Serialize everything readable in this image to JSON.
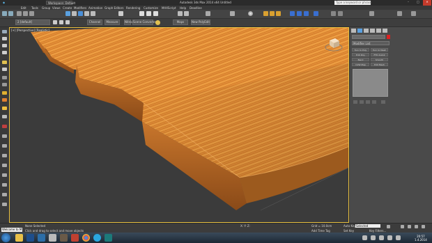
{
  "titlebar": {
    "workspace": "Workspace: Default",
    "title": "Autodesk 3ds Max 2014 x64    Untitled",
    "search_placeholder": "Type a keyword or phrase",
    "win_min": "–",
    "win_max": "□",
    "win_close": "✕"
  },
  "menus": [
    "Edit",
    "Tools",
    "Group",
    "Views",
    "Create",
    "Modifiers",
    "Animation",
    "Graph Editors",
    "Rendering",
    "Customize",
    "MAXScript",
    "Help",
    "Deadline"
  ],
  "toolbar2": {
    "selection_set": "2 [default]",
    "buttons": [
      "Channel",
      "Measure",
      "Nitrous",
      "Scene Converter",
      "Maps",
      "New PolyEdit"
    ]
  },
  "viewport": {
    "label": "[+] [Perspective] [Realistic]"
  },
  "command_panel": {
    "modifier_list": "Modifier List",
    "modifier_buttons": [
      "Turn to Poly",
      "Turn to Mesh",
      "Edit Poly",
      "FFD 2x2x2",
      "Bend",
      "Smooth",
      "UVW Map",
      "Edit Mesh"
    ]
  },
  "status": {
    "maxscript": "Welcome to M",
    "selection": "None Selected",
    "prompt": "Click and drag to select and move objects",
    "coords": "X:    Y:    Z:",
    "grid": "Grid = 10.0cm",
    "add_time_tag": "Add Time Tag",
    "auto_key": "Auto Key",
    "set_key": "Set Key",
    "key_mode": "Selected",
    "key_filters": "Key Filters..."
  },
  "taskbar": {
    "time": "20:57",
    "date": "1.4.2014"
  },
  "colors": {
    "wood_light": "#e8953a",
    "wood_dark": "#b85e1c",
    "viewport_bg": "#3b3b3b",
    "active_border": "#e8c040"
  }
}
